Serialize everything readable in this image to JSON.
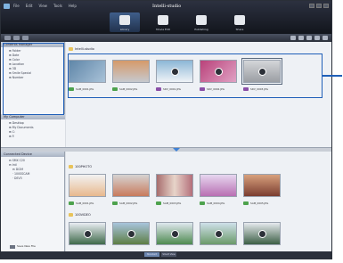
{
  "app": {
    "brand": "Intelli-studio",
    "menu": [
      "File",
      "Edit",
      "View",
      "Tools",
      "Help"
    ]
  },
  "modes": [
    {
      "label": "Library",
      "icon": "library-icon",
      "active": true
    },
    {
      "label": "Movie Edit",
      "icon": "film-icon",
      "active": false
    },
    {
      "label": "Publishing",
      "icon": "publish-icon",
      "active": false
    },
    {
      "label": "Share",
      "icon": "globe-icon",
      "active": false
    }
  ],
  "contents_manager": {
    "header": "Contents Manager",
    "items": [
      "Folder",
      "Date",
      "Color",
      "Location",
      "3D",
      "Smile Special",
      "Number"
    ]
  },
  "my_computer": {
    "header": "My Computer",
    "items": [
      "Desktop",
      "My Documents",
      "C:",
      "F:"
    ]
  },
  "connected_device": {
    "header": "Connected Device",
    "items": [
      "SMX C20",
      "Intl",
      "DCIM",
      "100SSCAM",
      "DEV3"
    ],
    "save_button": "Save New File"
  },
  "main_top": {
    "group": "Intelli-studio",
    "thumbs": [
      {
        "name": "SAM_0001.JPG",
        "badge_color": "#4da24d",
        "selected": false
      },
      {
        "name": "SAM_0002.JPG",
        "badge_color": "#4da24d",
        "selected": false
      },
      {
        "name": "SDV_0001.JPG",
        "badge_color": "#8a4fa8",
        "selected": false
      },
      {
        "name": "SDV_0002.JPG",
        "badge_color": "#8a4fa8",
        "selected": false
      },
      {
        "name": "SDV_0003.JPG",
        "badge_color": "#8a4fa8",
        "selected": true
      }
    ]
  },
  "main_bottom": {
    "group1": "100PHOTO",
    "thumbs1": [
      {
        "name": "SAM_0001.JPG"
      },
      {
        "name": "SAM_0002.JPG"
      },
      {
        "name": "SAM_0003.JPG"
      },
      {
        "name": "SAM_0004.JPG"
      },
      {
        "name": "SAM_0005.JPG"
      }
    ],
    "group2": "100VIDEO",
    "thumbs2": [
      {},
      {},
      {},
      {},
      {}
    ]
  },
  "statusbar": {
    "modes": [
      "Standard",
      "Smart View"
    ]
  }
}
